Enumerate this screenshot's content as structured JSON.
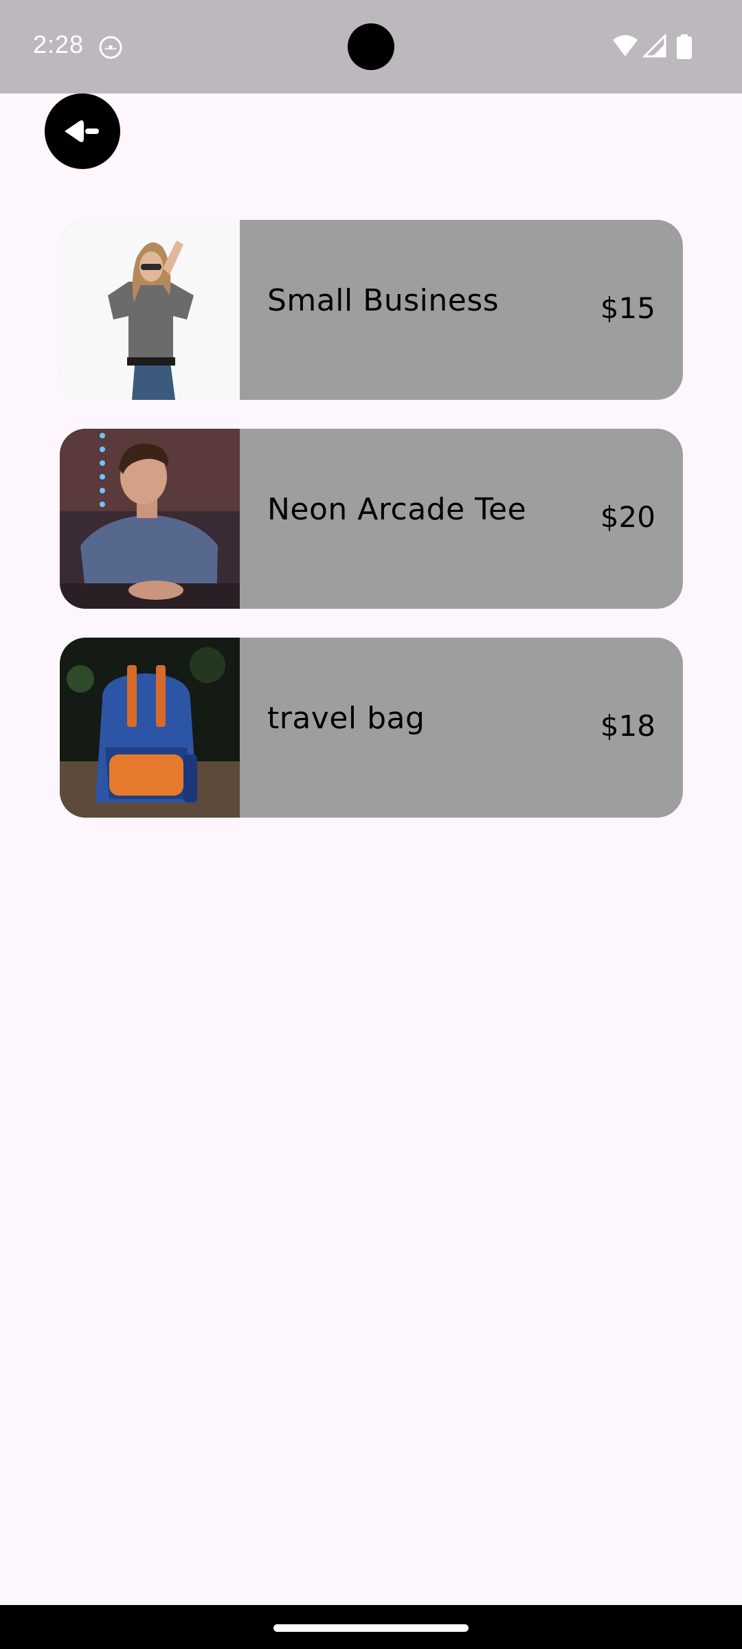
{
  "status_bar": {
    "time": "2:28",
    "app_icon": "android-robot-icon",
    "icons": [
      "wifi-icon",
      "cell-signal-icon",
      "battery-icon"
    ]
  },
  "header": {
    "back_icon": "back-arrow-icon"
  },
  "products": [
    {
      "name": "Small Business",
      "price": "$15",
      "image": "woman-gray-tee-photo"
    },
    {
      "name": "Neon Arcade Tee",
      "price": "$20",
      "image": "man-blue-tee-photo"
    },
    {
      "name": "travel bag",
      "price": "$18",
      "image": "blue-backpack-photo"
    }
  ],
  "colors": {
    "background": "#fdf6fd",
    "status_bar": "#bcb8bd",
    "card": "#9e9e9e",
    "text": "#000000"
  }
}
